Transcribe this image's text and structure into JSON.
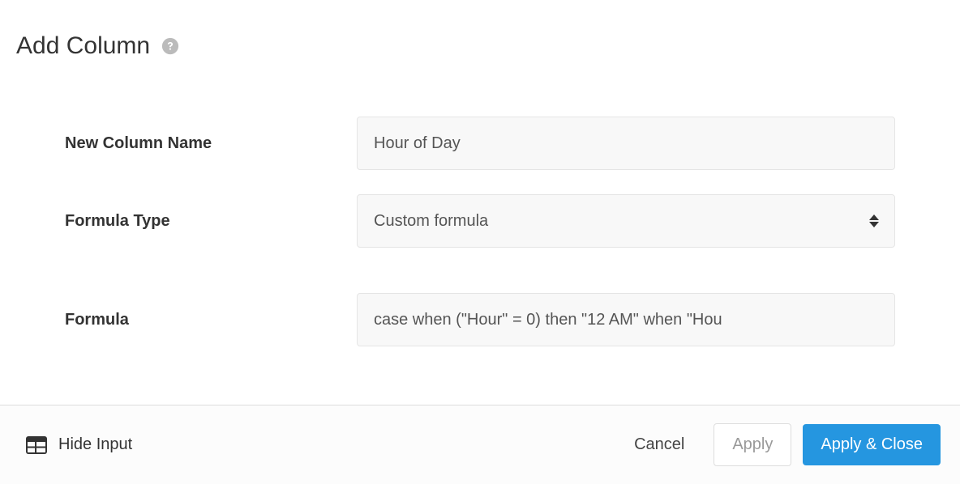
{
  "header": {
    "title": "Add Column"
  },
  "form": {
    "new_column_name": {
      "label": "New Column Name",
      "value": "Hour of Day"
    },
    "formula_type": {
      "label": "Formula Type",
      "value": "Custom formula"
    },
    "formula": {
      "label": "Formula",
      "value": "case when (\"Hour\" = 0) then \"12 AM\" when \"Hou"
    }
  },
  "footer": {
    "hide_input": "Hide Input",
    "cancel": "Cancel",
    "apply": "Apply",
    "apply_close": "Apply & Close"
  }
}
